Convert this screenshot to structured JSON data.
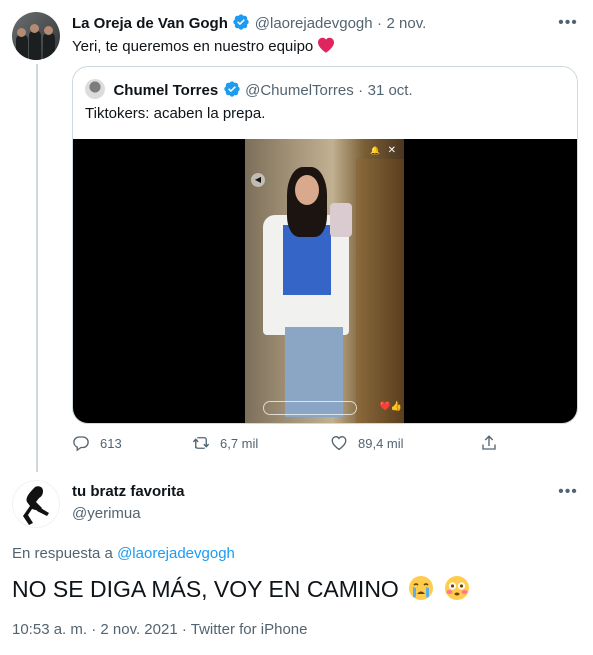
{
  "original_tweet": {
    "author_name": "La Oreja de Van Gogh",
    "author_handle": "@laorejadevgogh",
    "separator": "·",
    "date": "2 nov.",
    "text": "Yeri, te queremos en nuestro equipo",
    "emoji": "red-heart",
    "quoted_tweet": {
      "author_name": "Chumel Torres",
      "author_handle": "@ChumelTorres",
      "separator": "·",
      "date": "31 oct.",
      "text": "Tiktokers: acaben la prepa."
    },
    "actions": {
      "replies": "613",
      "retweets": "6,7 mil",
      "likes": "89,4 mil"
    }
  },
  "reply_tweet": {
    "author_name": "tu bratz favorita",
    "author_handle": "@yerimua",
    "reply_prefix": "En respuesta a",
    "reply_to_handle": "@laorejadevgogh",
    "text": "NO SE DIGA MÁS, VOY EN CAMINO",
    "emojis": [
      "crying-face",
      "flushed-face"
    ],
    "timestamp": "10:53 a. m.",
    "separator": "·",
    "date": "2 nov. 2021",
    "source": "Twitter for iPhone"
  },
  "colors": {
    "accent": "#1d9bf0",
    "secondary_text": "#536471",
    "heart": "#f91880",
    "verified": "#1d9bf0"
  }
}
